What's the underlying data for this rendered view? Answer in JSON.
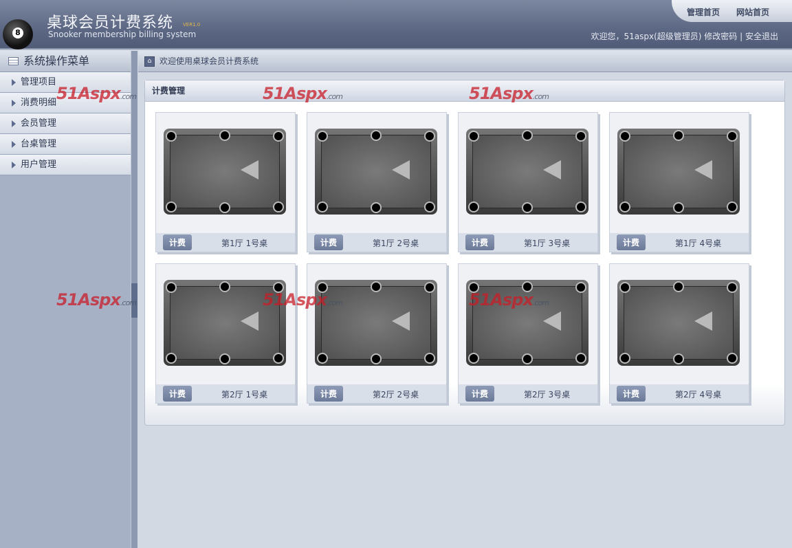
{
  "header": {
    "title": "桌球会员计费系统",
    "version": "VER1.0",
    "subtitle": "Snooker membership billing system",
    "links": [
      "管理首页",
      "网站首页"
    ],
    "welcome": "欢迎您，51aspx(超级管理员)",
    "change_password": "修改密码",
    "separator": "|",
    "logout": "安全退出"
  },
  "sidebar": {
    "title": "系统操作菜单",
    "items": [
      {
        "label": "管理项目"
      },
      {
        "label": "消费明细"
      },
      {
        "label": "会员管理"
      },
      {
        "label": "台桌管理"
      },
      {
        "label": "用户管理"
      }
    ]
  },
  "breadcrumb": "欢迎使用桌球会员计费系统",
  "panel": {
    "title": "计费管理",
    "button_label": "计费",
    "tables": [
      {
        "name": "第1厅 1号桌"
      },
      {
        "name": "第1厅 2号桌"
      },
      {
        "name": "第1厅 3号桌"
      },
      {
        "name": "第1厅 4号桌"
      },
      {
        "name": "第2厅 1号桌"
      },
      {
        "name": "第2厅 2号桌"
      },
      {
        "name": "第2厅 3号桌"
      },
      {
        "name": "第2厅 4号桌"
      }
    ]
  },
  "watermark": {
    "text": "51Aspx",
    "suffix": ".com"
  }
}
